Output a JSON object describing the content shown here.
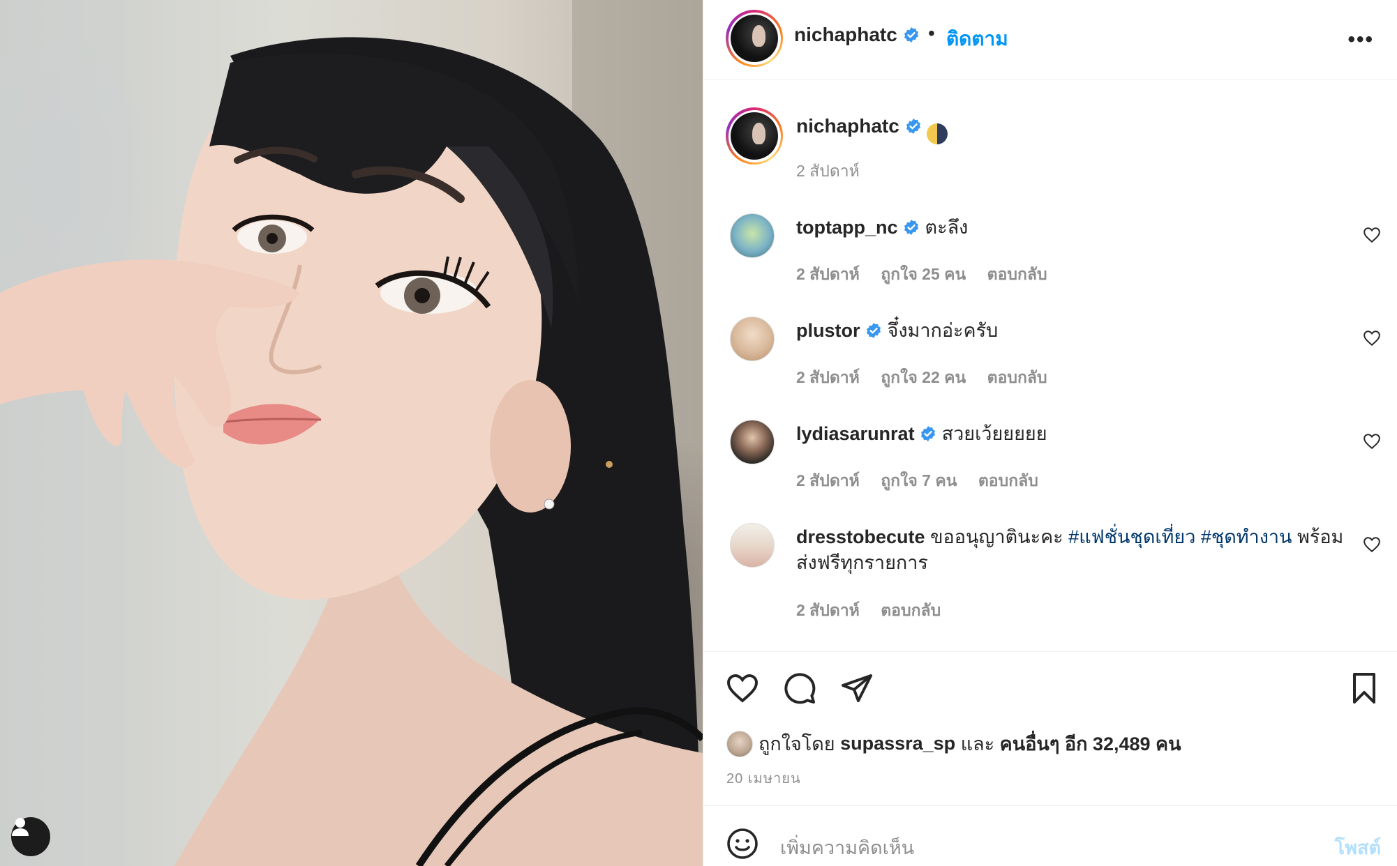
{
  "photo": {
    "description_icon": "person-icon"
  },
  "header": {
    "username": "nichaphatc",
    "separator": "•",
    "follow_label": "ติดตาม",
    "more_label": "•••"
  },
  "caption": {
    "username": "nichaphatc",
    "emoji": "🌗",
    "time": "2 สัปดาห์"
  },
  "comments": [
    {
      "username": "toptapp_nc",
      "text": "ตะลึง",
      "time": "2 สัปดาห์",
      "likes": "ถูกใจ 25 คน",
      "reply": "ตอบกลับ"
    },
    {
      "username": "plustor",
      "text": "จึ๋งมากอ่ะครับ",
      "time": "2 สัปดาห์",
      "likes": "ถูกใจ 22 คน",
      "reply": "ตอบกลับ"
    },
    {
      "username": "lydiasarunrat",
      "text": "สวยเว้ยยยยย",
      "time": "2 สัปดาห์",
      "likes": "ถูกใจ 7 คน",
      "reply": "ตอบกลับ"
    },
    {
      "username": "dresstobecute",
      "text_before": "ขออนุญาตินะคะ",
      "hashtag1": "#แฟชั่นชุดเที่ยว",
      "hashtag2": "#ชุดทำงาน",
      "text_after": "พร้อม",
      "text_line2": "ส่งฟรีทุกรายการ",
      "time": "2 สัปดาห์",
      "reply": "ตอบกลับ"
    }
  ],
  "likes": {
    "prefix": "ถูกใจโดย",
    "user": "supassra_sp",
    "and": "และ",
    "others": "คนอื่นๆ อีก 32,489 คน"
  },
  "date": "20 เมษายน",
  "compose": {
    "placeholder": "เพิ่มความคิดเห็น",
    "post_label": "โพสต์"
  },
  "colors": {
    "accent": "#0095f6",
    "verified": "#3897f0",
    "hashtag": "#00376b",
    "muted": "#8e8e8e"
  }
}
